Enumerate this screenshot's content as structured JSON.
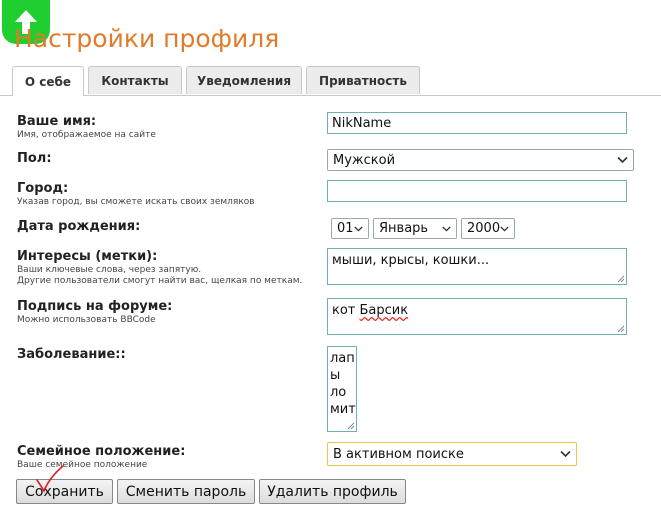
{
  "header": {
    "title": "Настройки профиля",
    "badge_icon": "up-arrow-icon"
  },
  "tabs": [
    {
      "label": "О себе",
      "active": true
    },
    {
      "label": "Контакты",
      "active": false
    },
    {
      "label": "Уведомления",
      "active": false
    },
    {
      "label": "Приватность",
      "active": false
    }
  ],
  "form": {
    "name": {
      "label": "Ваше имя:",
      "hint": "Имя, отображаемое на сайте",
      "value": "NikName"
    },
    "gender": {
      "label": "Пол:",
      "value": "Мужской"
    },
    "city": {
      "label": "Город:",
      "hint": "Указав город, вы сможете искать своих земляков",
      "value": ""
    },
    "birthdate": {
      "label": "Дата рождения:",
      "day": "01",
      "month": "Январь",
      "year": "2000"
    },
    "interests": {
      "label": "Интересы (метки):",
      "hint1": "Ваши ключевые слова, через запятую.",
      "hint2": "Другие пользователи смогут найти вас, щелкая по меткам.",
      "value": "мыши, крысы, кошки..."
    },
    "signature": {
      "label": "Подпись на форуме:",
      "hint": "Можно использовать BBCode",
      "value_part1": "кот ",
      "value_part2": "Барсик"
    },
    "illness": {
      "label": "Заболевание::",
      "lines": [
        "лап",
        "ы",
        "ло",
        "мит"
      ]
    },
    "family": {
      "label": "Семейное положение:",
      "hint": "Ваше семейное положение",
      "value": "В активном поиске"
    }
  },
  "buttons": {
    "save": "Сохранить",
    "change_password": "Сменить пароль",
    "delete_profile": "Удалить профиль"
  },
  "colors": {
    "title": "#e07b2a",
    "badge": "#1fcf2f",
    "field_border": "#6fb0b8",
    "family_border": "#e8c44a",
    "checkmark": "#e02020"
  }
}
